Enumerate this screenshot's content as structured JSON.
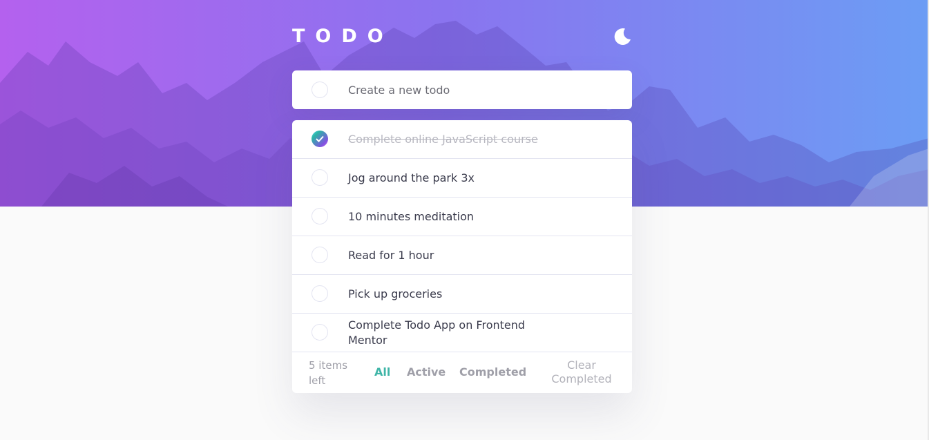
{
  "app": {
    "title": "TODO",
    "theme_icon": "moon-icon"
  },
  "new_todo": {
    "placeholder": "Create a new todo"
  },
  "todos": [
    {
      "text": "Complete online JavaScript course",
      "completed": true
    },
    {
      "text": "Jog around the park 3x",
      "completed": false
    },
    {
      "text": "10 minutes meditation",
      "completed": false
    },
    {
      "text": "Read for 1 hour",
      "completed": false
    },
    {
      "text": "Pick up groceries",
      "completed": false
    },
    {
      "text": "Complete Todo App on Frontend Mentor",
      "completed": false
    }
  ],
  "footer": {
    "items_left": "5 items left",
    "filters": {
      "all": "All",
      "active": "Active",
      "completed": "Completed"
    },
    "active_filter": "all",
    "clear_label": "Clear Completed"
  },
  "colors": {
    "accent": "#3fb5a7",
    "gradient_start": "#b461ee",
    "gradient_end": "#6c9df4",
    "check_gradient_start": "#55ddff",
    "check_gradient_end": "#c058f3",
    "text": "#393a4b",
    "muted": "#9f9fa8"
  }
}
